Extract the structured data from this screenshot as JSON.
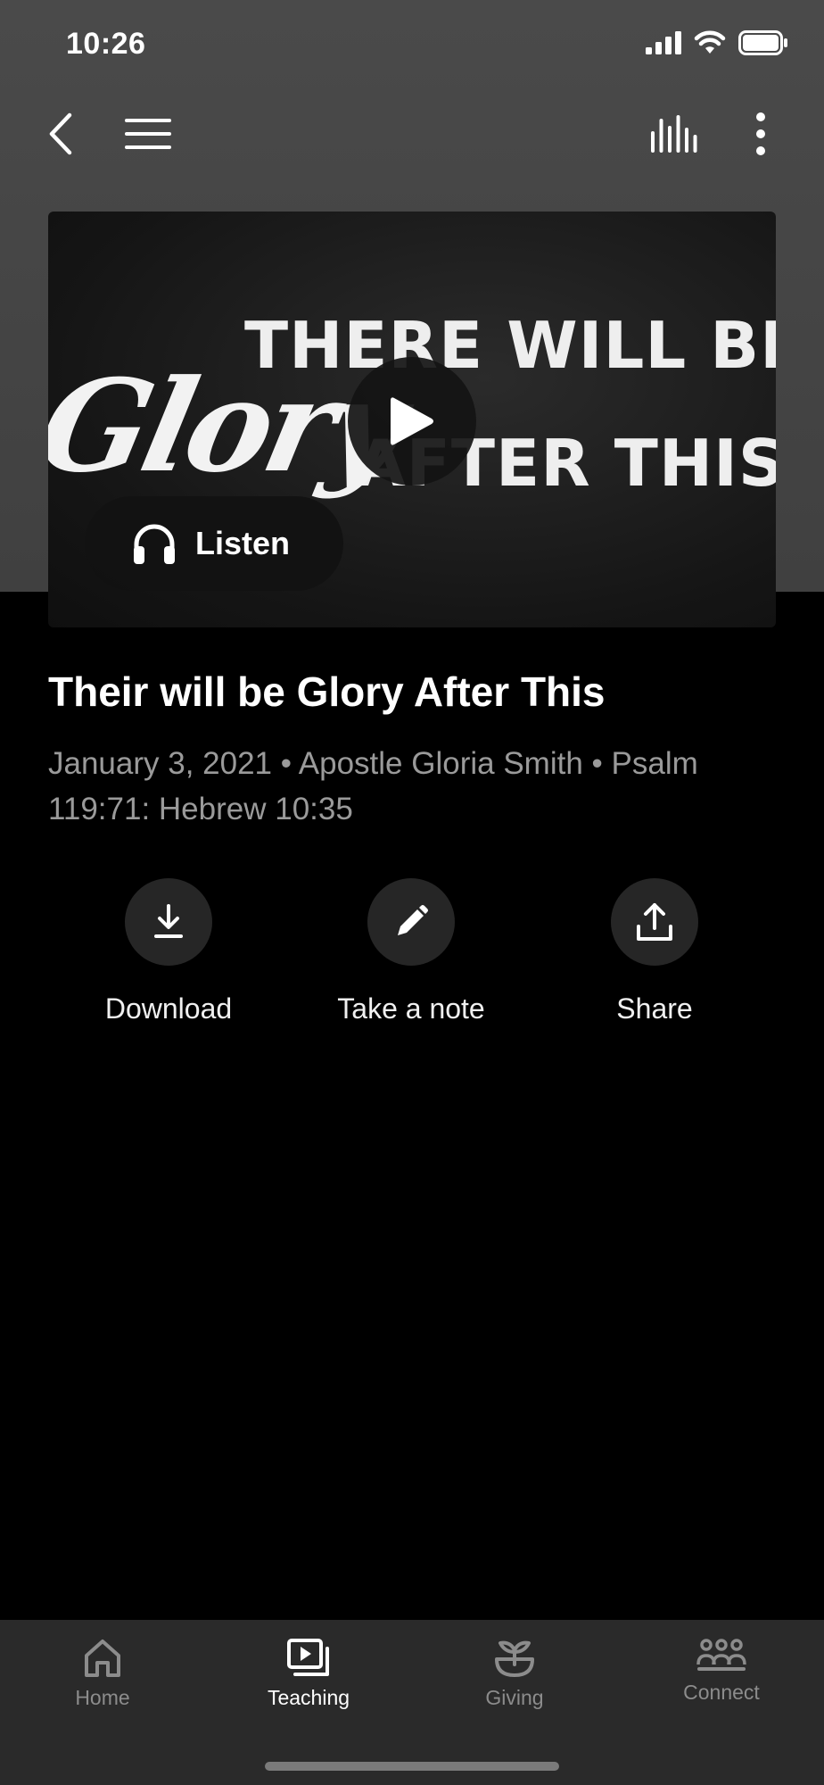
{
  "status_bar": {
    "time": "10:26"
  },
  "thumbnail": {
    "line1": "THERE WILL BE",
    "script_word": "Glory",
    "line2": "AFTER THIS"
  },
  "listen_label": "Listen",
  "sermon": {
    "title": "Their will be Glory After This",
    "meta": "January 3, 2021 • Apostle Gloria Smith • Psalm 119:71: Hebrew 10:35"
  },
  "actions": [
    {
      "label": "Download",
      "icon": "download-icon"
    },
    {
      "label": "Take a note",
      "icon": "pencil-icon"
    },
    {
      "label": "Share",
      "icon": "share-icon"
    }
  ],
  "tabs": [
    {
      "label": "Home",
      "icon": "home-icon",
      "active": false
    },
    {
      "label": "Teaching",
      "icon": "teaching-icon",
      "active": true
    },
    {
      "label": "Giving",
      "icon": "giving-icon",
      "active": false
    },
    {
      "label": "Connect",
      "icon": "connect-icon",
      "active": false
    }
  ],
  "colors": {
    "background": "#000000",
    "header": "#444444",
    "tab_bar": "#2a2a2a",
    "inactive_tab": "#8c8c8c"
  }
}
